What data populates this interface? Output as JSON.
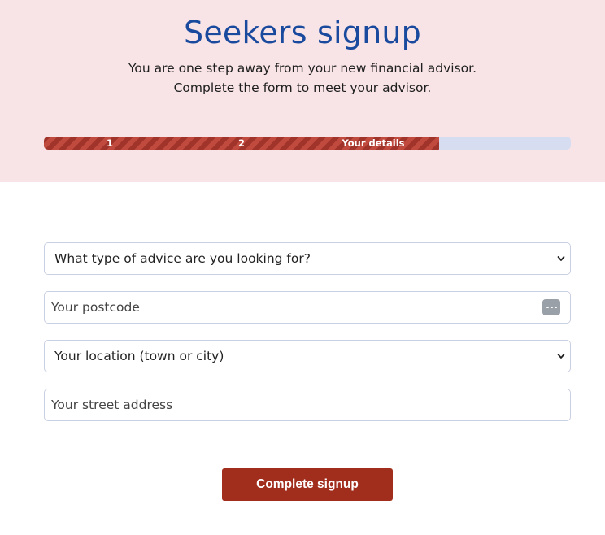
{
  "header": {
    "title": "Seekers signup",
    "subtitle_line1": "You are one step away from your new financial advisor.",
    "subtitle_line2": "Complete the form to meet your advisor."
  },
  "progress": {
    "steps": [
      "1",
      "2",
      "Your details"
    ],
    "completed_fraction": 0.75,
    "fill_color": "#a0332a",
    "track_color": "#d6ddf0"
  },
  "form": {
    "advice_type": {
      "selected": "What type of advice are you looking for?"
    },
    "postcode": {
      "placeholder": "Your postcode",
      "icon": "password-manager-icon"
    },
    "location": {
      "selected": "Your location (town or city)"
    },
    "street_address": {
      "placeholder": "Your street address"
    },
    "submit_label": "Complete signup"
  },
  "colors": {
    "hero_background": "#f8e4e6",
    "title": "#1a4a9e",
    "button": "#a12d1c"
  }
}
